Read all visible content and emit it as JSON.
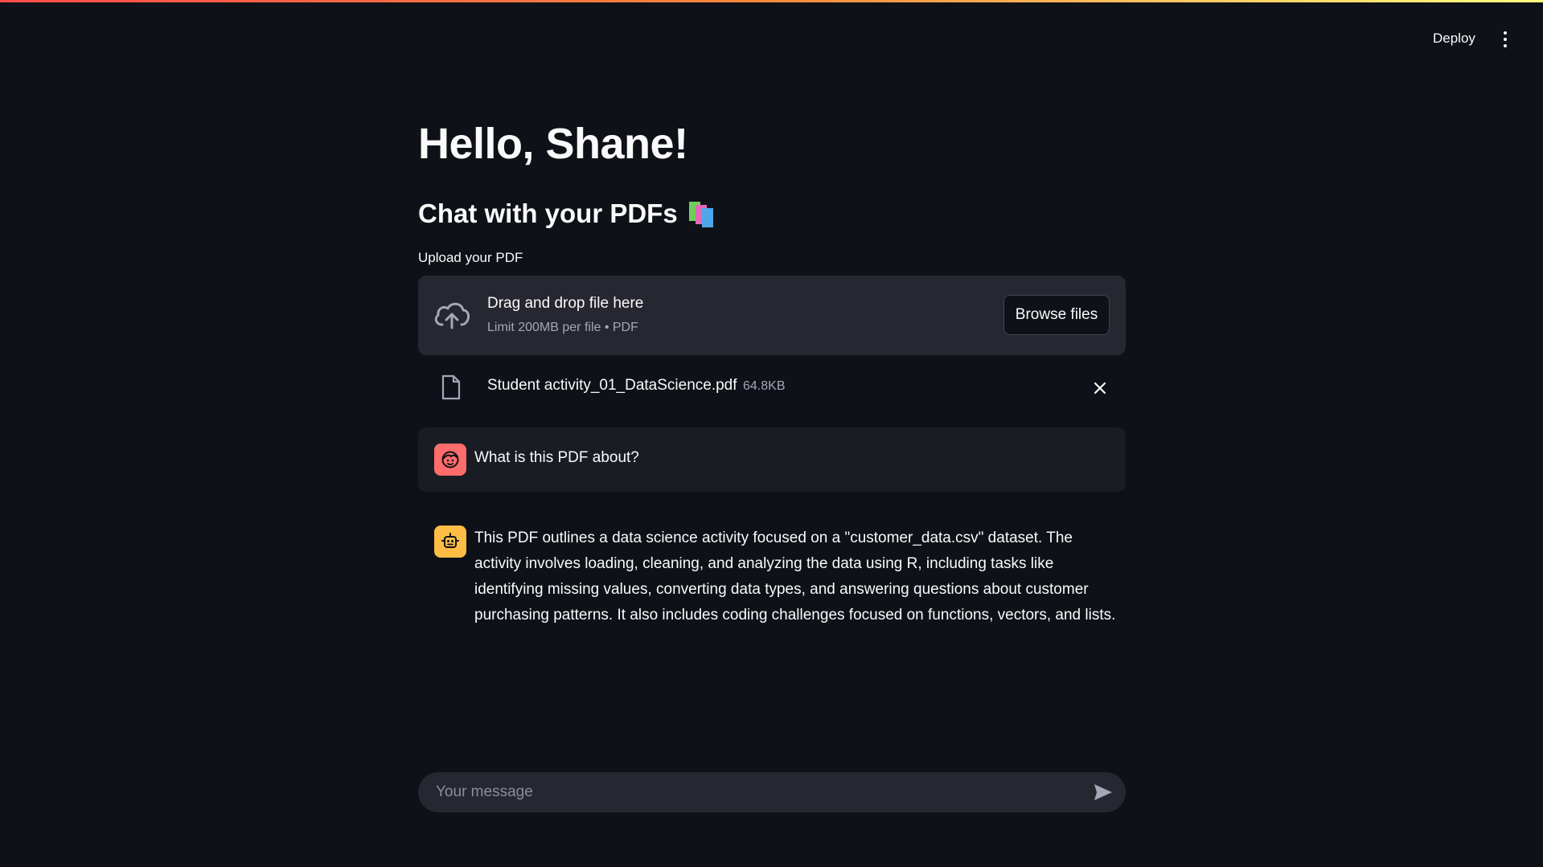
{
  "header": {
    "deploy_label": "Deploy",
    "menu_icon": "more-vertical-icon"
  },
  "main": {
    "title": "Hello, Shane!",
    "subtitle": "Chat with your PDFs",
    "subtitle_icon": "books-icon"
  },
  "uploader": {
    "label": "Upload your PDF",
    "dropzone_title": "Drag and drop file here",
    "dropzone_limit": "Limit 200MB per file • PDF",
    "browse_label": "Browse files",
    "upload_icon": "cloud-upload-icon"
  },
  "uploaded_file": {
    "name": "Student activity_01_DataScience.pdf",
    "size": "64.8KB",
    "file_icon": "file-icon",
    "remove_icon": "close-icon"
  },
  "chat": {
    "messages": [
      {
        "role": "user",
        "avatar_icon": "user-face-icon",
        "text": "What is this PDF about?"
      },
      {
        "role": "assistant",
        "avatar_icon": "robot-icon",
        "text": "This PDF outlines a data science activity focused on a \"customer_data.csv\" dataset. The activity involves loading, cleaning, and analyzing the data using R, including tasks like identifying missing values, converting data types, and answering questions about customer purchasing patterns. It also includes coding challenges focused on functions, vectors, and lists."
      }
    ],
    "input": {
      "placeholder": "Your message",
      "value": "",
      "send_icon": "send-icon"
    }
  },
  "colors": {
    "background": "#0e1117",
    "panel": "#262730",
    "user_avatar": "#ff6c6c",
    "bot_avatar": "#ffbd45",
    "accent_red": "#ff4b4b"
  }
}
